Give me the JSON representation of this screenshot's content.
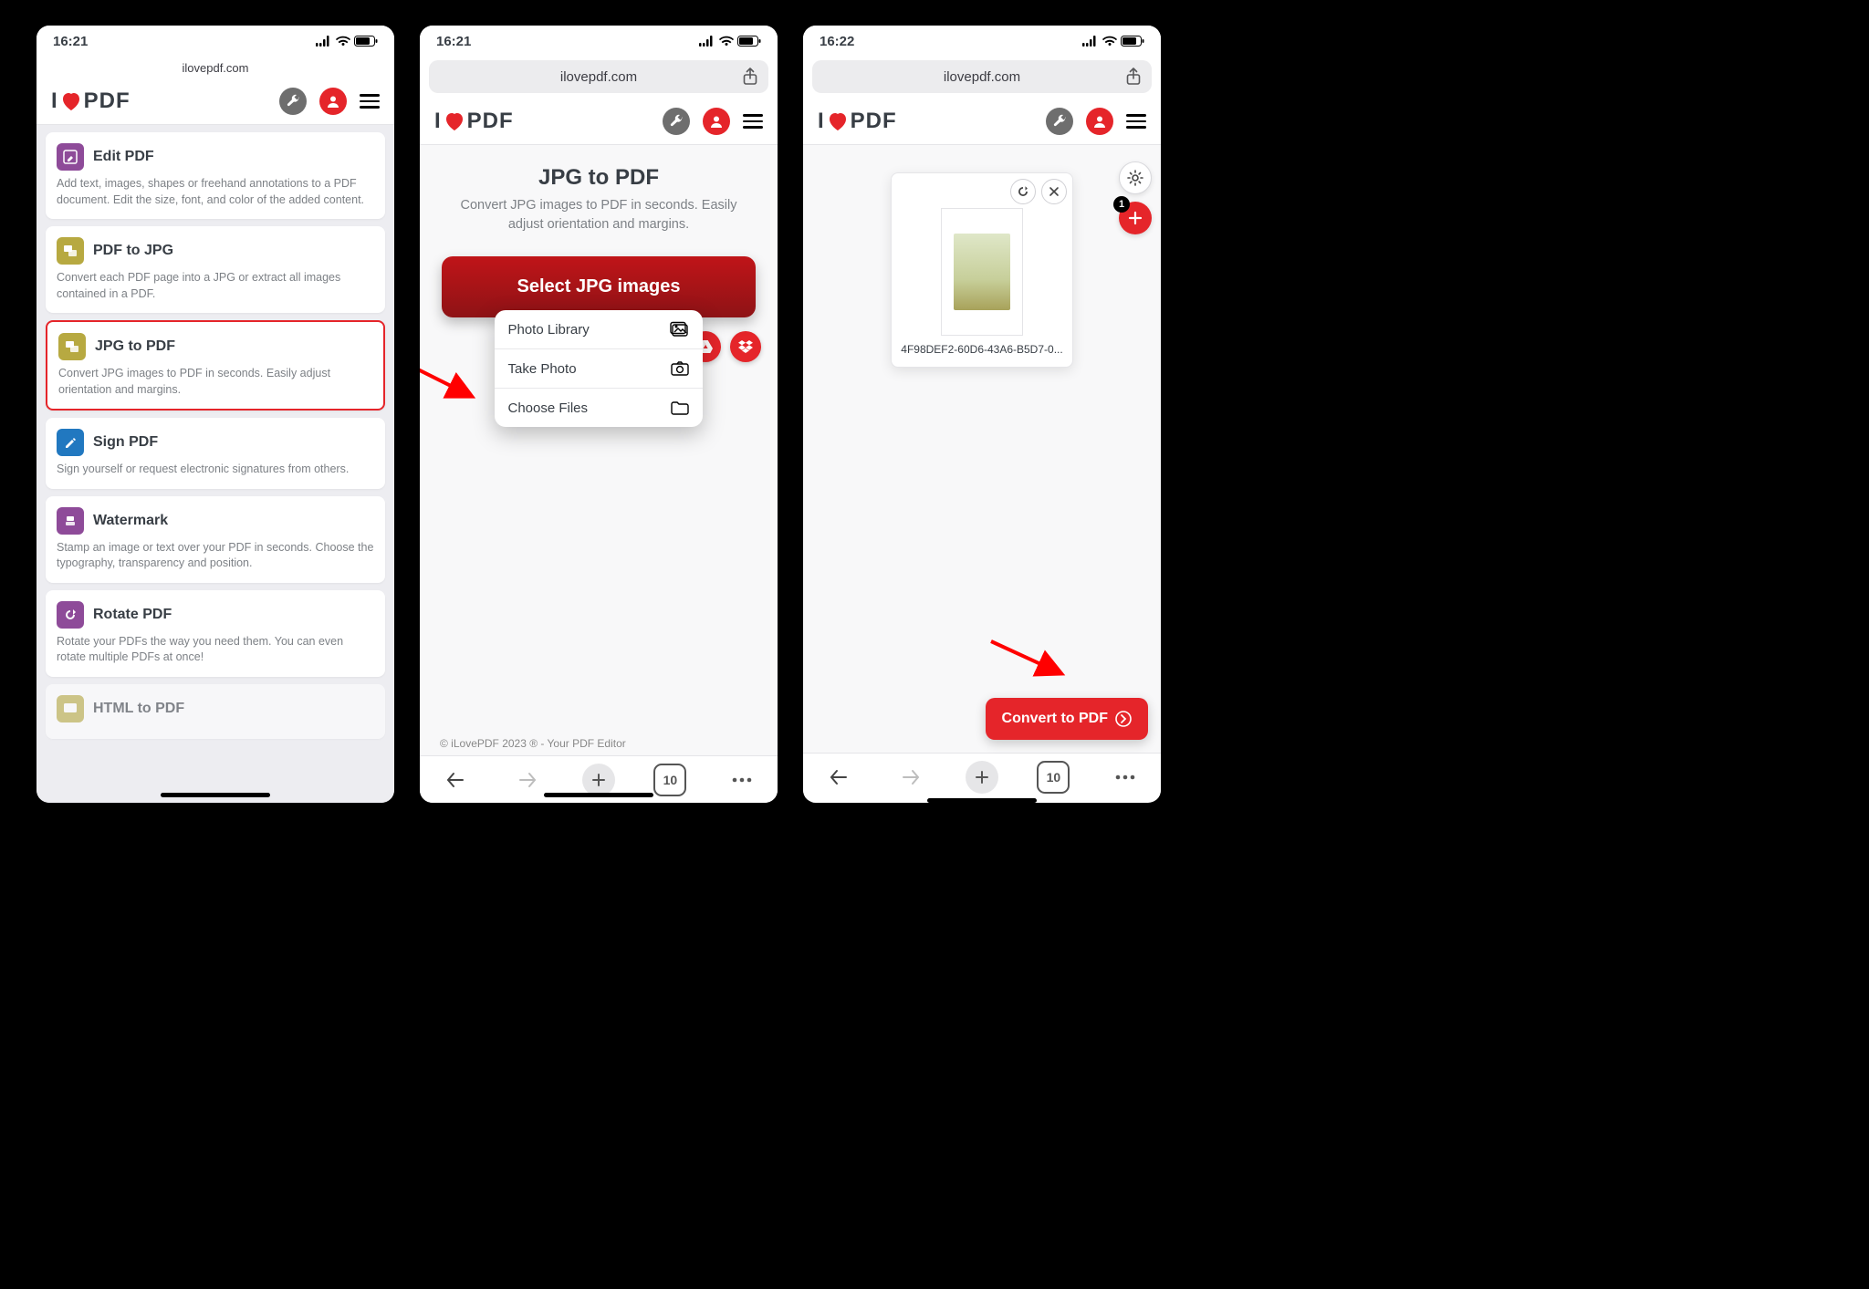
{
  "screen1": {
    "status_time": "16:21",
    "url": "ilovepdf.com",
    "logo_i": "I",
    "logo_pdf": "PDF",
    "cards": [
      {
        "title": "Edit PDF",
        "desc": "Add text, images, shapes or freehand annotations to a PDF document. Edit the size, font, and color of the added content."
      },
      {
        "title": "PDF to JPG",
        "desc": "Convert each PDF page into a JPG or extract all images contained in a PDF."
      },
      {
        "title": "JPG to PDF",
        "desc": "Convert JPG images to PDF in seconds. Easily adjust orientation and margins."
      },
      {
        "title": "Sign PDF",
        "desc": "Sign yourself or request electronic signatures from others."
      },
      {
        "title": "Watermark",
        "desc": "Stamp an image or text over your PDF in seconds. Choose the typography, transparency and position."
      },
      {
        "title": "Rotate PDF",
        "desc": "Rotate your PDFs the way you need them. You can even rotate multiple PDFs at once!"
      },
      {
        "title": "HTML to PDF",
        "desc": ""
      }
    ]
  },
  "screen2": {
    "status_time": "16:21",
    "url": "ilovepdf.com",
    "hero_title": "JPG to PDF",
    "hero_desc": "Convert JPG images to PDF in seconds. Easily adjust orientation and margins.",
    "select_label": "Select JPG images",
    "picker": [
      {
        "label": "Photo Library"
      },
      {
        "label": "Take Photo"
      },
      {
        "label": "Choose Files"
      }
    ],
    "footer": "© iLovePDF 2023 ® - Your PDF Editor",
    "tabs_count": "10"
  },
  "screen3": {
    "status_time": "16:22",
    "url": "ilovepdf.com",
    "file_name": "4F98DEF2-60D6-43A6-B5D7-0...",
    "convert_label": "Convert to PDF",
    "add_badge": "1",
    "tabs_count": "10"
  }
}
